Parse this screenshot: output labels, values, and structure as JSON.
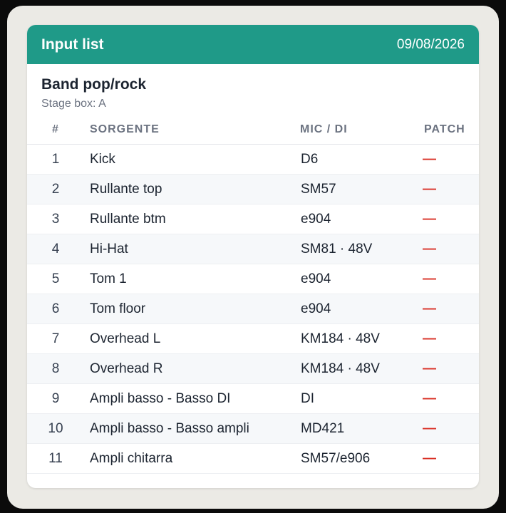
{
  "header": {
    "title": "Input list",
    "date": "09/08/2026"
  },
  "band": {
    "name": "Band pop/rock",
    "stage_box": "Stage box: A"
  },
  "table": {
    "columns": [
      "#",
      "SORGENTE",
      "MIC / DI",
      "PATCH"
    ],
    "rows": [
      {
        "num": "1",
        "source": "Kick",
        "mic": "D6",
        "patch": "—"
      },
      {
        "num": "2",
        "source": "Rullante top",
        "mic": "SM57",
        "patch": "—"
      },
      {
        "num": "3",
        "source": "Rullante btm",
        "mic": "e904",
        "patch": "—"
      },
      {
        "num": "4",
        "source": "Hi-Hat",
        "mic": "SM81 · 48V",
        "patch": "—"
      },
      {
        "num": "5",
        "source": "Tom 1",
        "mic": "e904",
        "patch": "—"
      },
      {
        "num": "6",
        "source": "Tom floor",
        "mic": "e904",
        "patch": "—"
      },
      {
        "num": "7",
        "source": "Overhead L",
        "mic": "KM184 · 48V",
        "patch": "—"
      },
      {
        "num": "8",
        "source": "Overhead R",
        "mic": "KM184 · 48V",
        "patch": "—"
      },
      {
        "num": "9",
        "source": "Ampli basso - Basso DI",
        "mic": "DI",
        "patch": "—"
      },
      {
        "num": "10",
        "source": "Ampli basso - Basso ampli",
        "mic": "MD421",
        "patch": "—"
      },
      {
        "num": "11",
        "source": "Ampli chitarra",
        "mic": "SM57/e906",
        "patch": "—"
      }
    ]
  },
  "colors": {
    "header_bg": "#1f9a88",
    "patch_dash": "#d93025"
  }
}
